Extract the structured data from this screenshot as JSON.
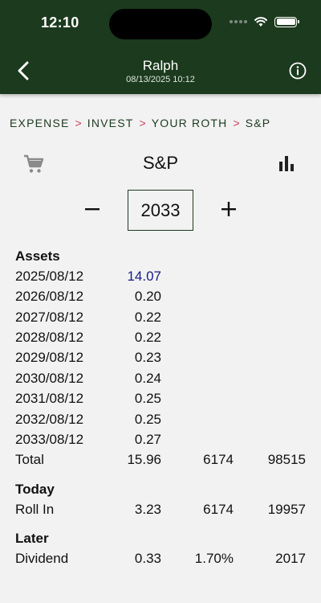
{
  "status_bar": {
    "time": "12:10"
  },
  "nav": {
    "title": "Ralph",
    "subtitle": "08/13/2025 10:12"
  },
  "breadcrumb": [
    "EXPENSE",
    "INVEST",
    "YOUR ROTH",
    "S&P"
  ],
  "breadcrumb_separator": ">",
  "page": {
    "title": "S&P"
  },
  "stepper": {
    "year": "2033",
    "minus": "−",
    "plus": "+"
  },
  "assets": {
    "title": "Assets",
    "rows": [
      {
        "date": "2025/08/12",
        "value": "14.07"
      },
      {
        "date": "2026/08/12",
        "value": "0.20"
      },
      {
        "date": "2027/08/12",
        "value": "0.22"
      },
      {
        "date": "2028/08/12",
        "value": "0.22"
      },
      {
        "date": "2029/08/12",
        "value": "0.23"
      },
      {
        "date": "2030/08/12",
        "value": "0.24"
      },
      {
        "date": "2031/08/12",
        "value": "0.25"
      },
      {
        "date": "2032/08/12",
        "value": "0.25"
      },
      {
        "date": "2033/08/12",
        "value": "0.27"
      }
    ],
    "total": {
      "label": "Total",
      "v1": "15.96",
      "v2": "6174",
      "v3": "98515"
    }
  },
  "today": {
    "title": "Today",
    "row": {
      "label": "Roll In",
      "v1": "3.23",
      "v2": "6174",
      "v3": "19957"
    }
  },
  "later": {
    "title": "Later",
    "row": {
      "label": "Dividend",
      "v1": "0.33",
      "v2": "1.70%",
      "v3": "2017"
    }
  },
  "colors": {
    "header_bg": "#1c3a1e",
    "separator": "#d0405a",
    "highlight": "#1a1a8a"
  }
}
